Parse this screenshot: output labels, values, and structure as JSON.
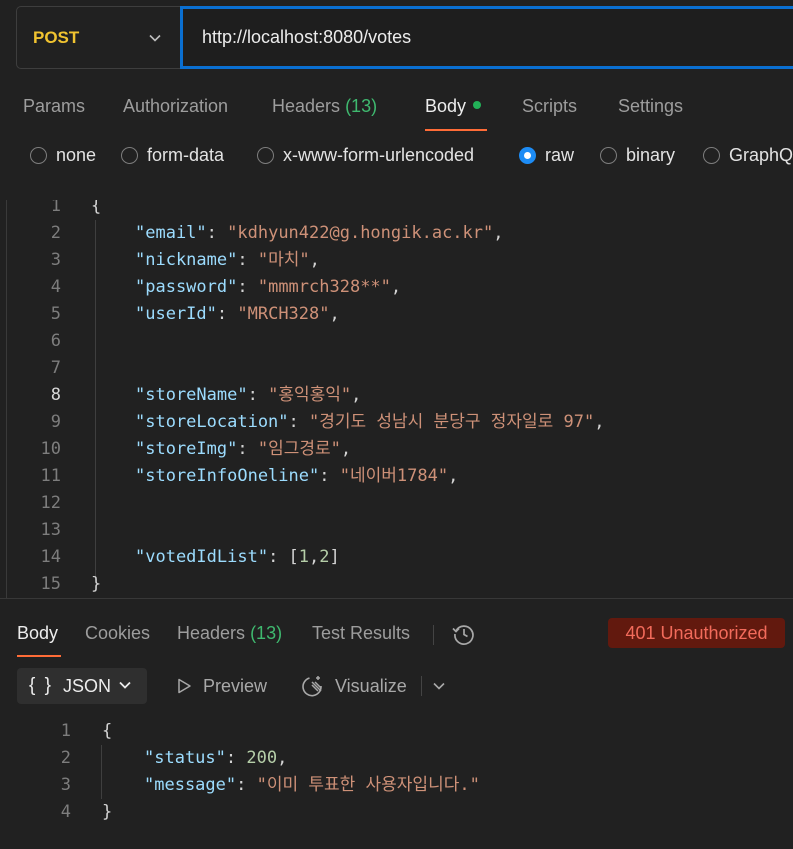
{
  "request": {
    "method": "POST",
    "url": "http://localhost:8080/votes"
  },
  "request_tabs": {
    "params": "Params",
    "authorization": "Authorization",
    "headers": "Headers",
    "headers_count": "(13)",
    "body": "Body",
    "scripts": "Scripts",
    "settings": "Settings"
  },
  "body_types": {
    "none": "none",
    "form_data": "form-data",
    "urlencoded": "x-www-form-urlencoded",
    "raw": "raw",
    "binary": "binary",
    "graphql": "GraphQ",
    "selected": "raw"
  },
  "request_body": {
    "line_numbers": [
      "1",
      "2",
      "3",
      "4",
      "5",
      "6",
      "7",
      "8",
      "9",
      "10",
      "11",
      "12",
      "13",
      "14",
      "15"
    ],
    "open_brace": "{",
    "close_brace": "}",
    "email_key": "\"email\"",
    "email_value": "\"kdhyun422@g.hongik.ac.kr\"",
    "nickname_key": "\"nickname\"",
    "nickname_value": "\"마치\"",
    "password_key": "\"password\"",
    "password_value": "\"mmmrch328**\"",
    "userid_key": "\"userId\"",
    "userid_value": "\"MRCH328\"",
    "storename_key": "\"storeName\"",
    "storename_value": "\"홍익홍익\"",
    "storelocation_key": "\"storeLocation\"",
    "storelocation_value": "\"경기도 성남시 분당구 정자일로 97\"",
    "storeimg_key": "\"storeImg\"",
    "storeimg_value": "\"임그경로\"",
    "storeinfo_key": "\"storeInfoOneline\"",
    "storeinfo_value": "\"네이버1784\"",
    "votedidlist_key": "\"votedIdList\"",
    "votedidlist_open": "[",
    "votedidlist_v1": "1",
    "votedidlist_v2": "2",
    "votedidlist_close": "]"
  },
  "response_tabs": {
    "body": "Body",
    "cookies": "Cookies",
    "headers": "Headers",
    "headers_count": "(13)",
    "test_results": "Test Results",
    "status": "401 Unauthorized"
  },
  "response_toolbar": {
    "format": "JSON",
    "preview": "Preview",
    "visualize": "Visualize"
  },
  "response_body": {
    "line_numbers": [
      "1",
      "2",
      "3",
      "4"
    ],
    "open_brace": "{",
    "close_brace": "}",
    "status_key": "\"status\"",
    "status_value": "200",
    "message_key": "\"message\"",
    "message_value": "\"이미 투표한 사용자입니다.\""
  },
  "colors": {
    "accent": "#ff6c37",
    "method": "#f0c330",
    "url_focus": "#0a6fd1",
    "status_bg": "#62190e",
    "status_text": "#f26b5b",
    "count_green": "#3fb96f"
  }
}
